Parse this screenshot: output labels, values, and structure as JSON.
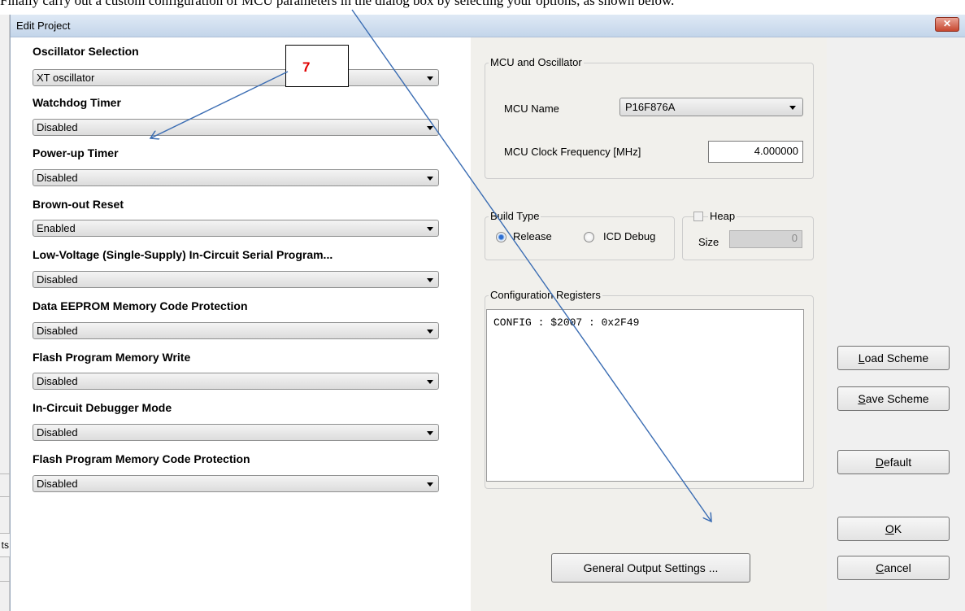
{
  "document": {
    "text_fragment": "Finally carry out a custom configuration of MCU parameters in the dialog box by selecting your options, as shown below."
  },
  "background_app": {
    "tab_label": "ts"
  },
  "dialog": {
    "title": "Edit Project",
    "close_symbol": "✕"
  },
  "config_options": [
    {
      "label": "Oscillator Selection",
      "value": "XT oscillator"
    },
    {
      "label": "Watchdog Timer",
      "value": "Disabled"
    },
    {
      "label": "Power-up Timer",
      "value": "Disabled"
    },
    {
      "label": "Brown-out Reset",
      "value": "Enabled"
    },
    {
      "label": "Low-Voltage (Single-Supply) In-Circuit Serial Program...",
      "value": "Disabled"
    },
    {
      "label": "Data EEPROM Memory Code Protection",
      "value": "Disabled"
    },
    {
      "label": "Flash Program Memory Write",
      "value": "Disabled"
    },
    {
      "label": "In-Circuit Debugger Mode",
      "value": "Disabled"
    },
    {
      "label": "Flash Program Memory Code Protection",
      "value": "Disabled"
    }
  ],
  "mcu_oscillator": {
    "group_title": "MCU and Oscillator",
    "mcu_name_label": "MCU Name",
    "mcu_name_value": "P16F876A",
    "clock_label": "MCU Clock Frequency [MHz]",
    "clock_value": "4.000000"
  },
  "build_type": {
    "group_title": "Build Type",
    "release_label": "Release",
    "release_checked": true,
    "icd_label": "ICD Debug",
    "icd_checked": false
  },
  "heap": {
    "group_title": "Heap",
    "checked": false,
    "size_label": "Size",
    "size_value": "0"
  },
  "config_registers": {
    "group_title": "Configuration Registers",
    "text": "CONFIG : $2007 : 0x2F49"
  },
  "buttons": {
    "general_output": "General Output Settings ...",
    "load_scheme": {
      "mnemonic": "L",
      "rest": "oad Scheme"
    },
    "save_scheme": {
      "mnemonic": "S",
      "rest": "ave Scheme"
    },
    "default": {
      "mnemonic": "D",
      "rest": "efault"
    },
    "ok": {
      "mnemonic": "O",
      "rest": "K"
    },
    "cancel": {
      "mnemonic": "C",
      "rest": "ancel"
    }
  },
  "annotation": {
    "callout_number": "7",
    "arrow_color": "#3b6db3",
    "callout_text_color": "#e00000"
  }
}
